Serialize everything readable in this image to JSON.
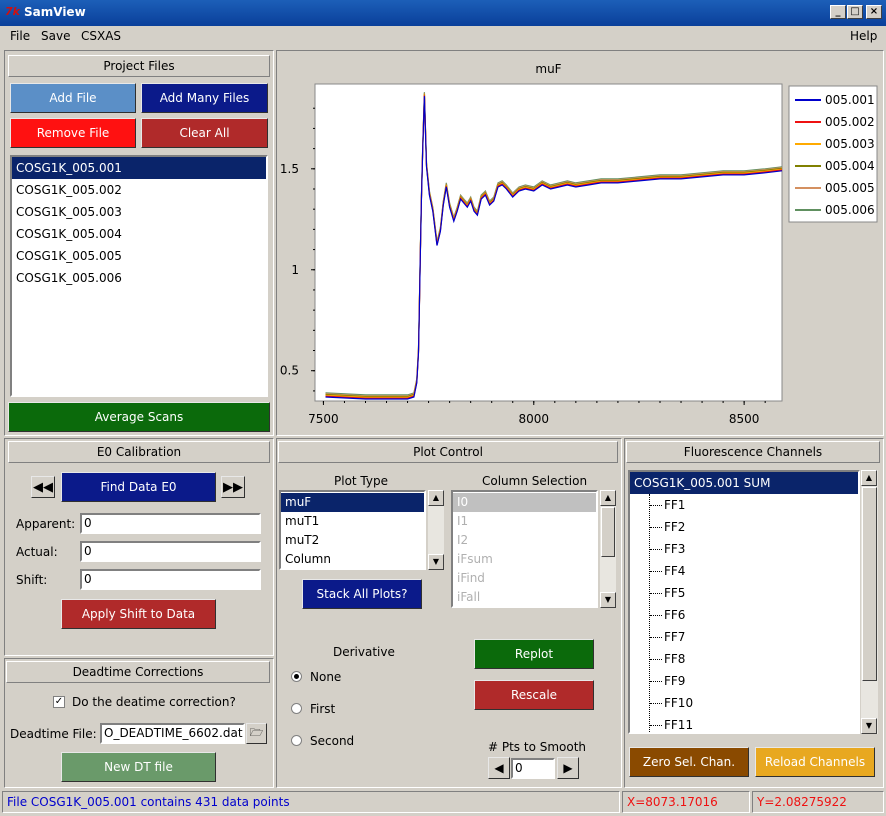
{
  "window": {
    "title": "SamView",
    "icon": "tk-feather-icon"
  },
  "menu": {
    "file": "File",
    "save": "Save",
    "csxas": "CSXAS",
    "help": "Help"
  },
  "project": {
    "header": "Project Files",
    "add_file": "Add File",
    "add_many": "Add Many Files",
    "remove_file": "Remove File",
    "clear_all": "Clear All",
    "files": [
      "COSG1K_005.001",
      "COSG1K_005.002",
      "COSG1K_005.003",
      "COSG1K_005.004",
      "COSG1K_005.005",
      "COSG1K_005.006"
    ],
    "selected_index": 0,
    "average": "Average Scans"
  },
  "chart_data": {
    "type": "line",
    "title": "muF",
    "xlabel": "",
    "ylabel": "",
    "xlim": [
      7480,
      8590
    ],
    "ylim": [
      0.35,
      1.92
    ],
    "xticks": [
      7500,
      8000,
      8500
    ],
    "yticks": [
      0.5,
      1,
      1.5
    ],
    "legend_position": "top-right",
    "series": [
      {
        "name": "005.001",
        "color": "#0000cc"
      },
      {
        "name": "005.002",
        "color": "#ee1111"
      },
      {
        "name": "005.003",
        "color": "#ffaa00"
      },
      {
        "name": "005.004",
        "color": "#808000"
      },
      {
        "name": "005.005",
        "color": "#d49060"
      },
      {
        "name": "005.006",
        "color": "#609060"
      }
    ],
    "x": [
      7505,
      7600,
      7700,
      7715,
      7722,
      7726,
      7728,
      7730,
      7733,
      7736,
      7740,
      7745,
      7752,
      7760,
      7770,
      7778,
      7785,
      7792,
      7800,
      7810,
      7818,
      7826,
      7834,
      7842,
      7850,
      7858,
      7866,
      7875,
      7885,
      7895,
      7905,
      7915,
      7925,
      7935,
      7950,
      7965,
      7980,
      8000,
      8020,
      8040,
      8060,
      8080,
      8100,
      8130,
      8160,
      8200,
      8250,
      8300,
      8350,
      8400,
      8450,
      8500,
      8550,
      8590
    ],
    "y": [
      0.38,
      0.37,
      0.37,
      0.38,
      0.45,
      0.6,
      0.8,
      1.05,
      1.35,
      1.6,
      1.87,
      1.52,
      1.38,
      1.3,
      1.13,
      1.2,
      1.33,
      1.42,
      1.32,
      1.25,
      1.3,
      1.36,
      1.34,
      1.32,
      1.35,
      1.3,
      1.28,
      1.36,
      1.38,
      1.33,
      1.35,
      1.42,
      1.43,
      1.41,
      1.37,
      1.4,
      1.41,
      1.4,
      1.43,
      1.41,
      1.42,
      1.43,
      1.42,
      1.43,
      1.44,
      1.44,
      1.45,
      1.46,
      1.46,
      1.47,
      1.48,
      1.48,
      1.49,
      1.5
    ]
  },
  "e0": {
    "header": "E0 Calibration",
    "find": "Find Data E0",
    "apparent_label": "Apparent:",
    "apparent": "0",
    "actual_label": "Actual:",
    "actual": "0",
    "shift_label": "Shift:",
    "shift": "0",
    "apply": "Apply Shift to Data"
  },
  "deadtime": {
    "header": "Deadtime Corrections",
    "checkbox": "Do the deatime correction?",
    "file_label": "Deadtime File:",
    "file_value": "O_DEADTIME_6602.dat",
    "new_btn": "New DT file"
  },
  "plot_control": {
    "header": "Plot Control",
    "plot_type_label": "Plot Type",
    "plot_types": [
      "muF",
      "muT1",
      "muT2",
      "Column"
    ],
    "column_label": "Column Selection",
    "columns": [
      "I0",
      "I1",
      "I2",
      "iFsum",
      "iFind",
      "iFall"
    ],
    "stack": "Stack All Plots?",
    "derivative_label": "Derivative",
    "deriv_none": "None",
    "deriv_first": "First",
    "deriv_second": "Second",
    "replot": "Replot",
    "rescale": "Rescale",
    "smooth_label": "# Pts to Smooth",
    "smooth_value": "0"
  },
  "fluor": {
    "header": "Fluorescence Channels",
    "root": "COSG1K_005.001 SUM",
    "channels": [
      "FF1",
      "FF2",
      "FF3",
      "FF4",
      "FF5",
      "FF6",
      "FF7",
      "FF8",
      "FF9",
      "FF10",
      "FF11"
    ],
    "zero": "Zero Sel. Chan.",
    "reload": "Reload Channels"
  },
  "status": {
    "message": "File COSG1K_005.001 contains 431 data points",
    "x": "X=8073.17016",
    "y": "Y=2.08275922"
  },
  "colors": {
    "blue_btn": "#5b8fc7",
    "navy_btn": "#0b1a8a",
    "red_btn": "#ff1111",
    "brick_btn": "#b02a2a",
    "green_btn": "#0b6a0b",
    "sage_btn": "#6a9a6a",
    "orange_btn": "#8a4a00",
    "gold_btn": "#e8a820"
  }
}
